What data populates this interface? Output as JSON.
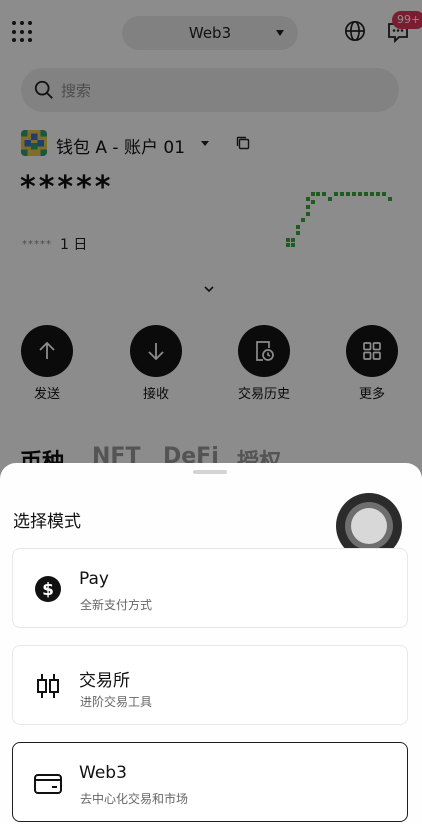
{
  "header": {
    "mode_label": "Web3",
    "notification_badge": "99+"
  },
  "search": {
    "placeholder": "搜索"
  },
  "account": {
    "name": "钱包 A - 账户 01",
    "balance_masked": "*****",
    "change_masked": "*****",
    "period": "1 日"
  },
  "quick_actions": [
    {
      "label": "发送",
      "icon": "arrow-up-icon"
    },
    {
      "label": "接收",
      "icon": "arrow-down-icon"
    },
    {
      "label": "交易历史",
      "icon": "history-icon"
    },
    {
      "label": "更多",
      "icon": "grid-icon"
    }
  ],
  "asset_tabs": [
    "币种",
    "NFT",
    "DeFi",
    "授权"
  ],
  "sheet": {
    "title": "选择模式",
    "options": [
      {
        "title": "Pay",
        "desc": "全新支付方式",
        "icon": "dollar-coin-icon",
        "selected": false
      },
      {
        "title": "交易所",
        "desc": "进阶交易工具",
        "icon": "candlestick-icon",
        "selected": false
      },
      {
        "title": "Web3",
        "desc": "去中心化交易和市场",
        "icon": "wallet-icon",
        "selected": true
      }
    ]
  },
  "colors": {
    "accent_green": "#3aa83a",
    "badge_red": "#e0365a",
    "dark": "#141414"
  }
}
